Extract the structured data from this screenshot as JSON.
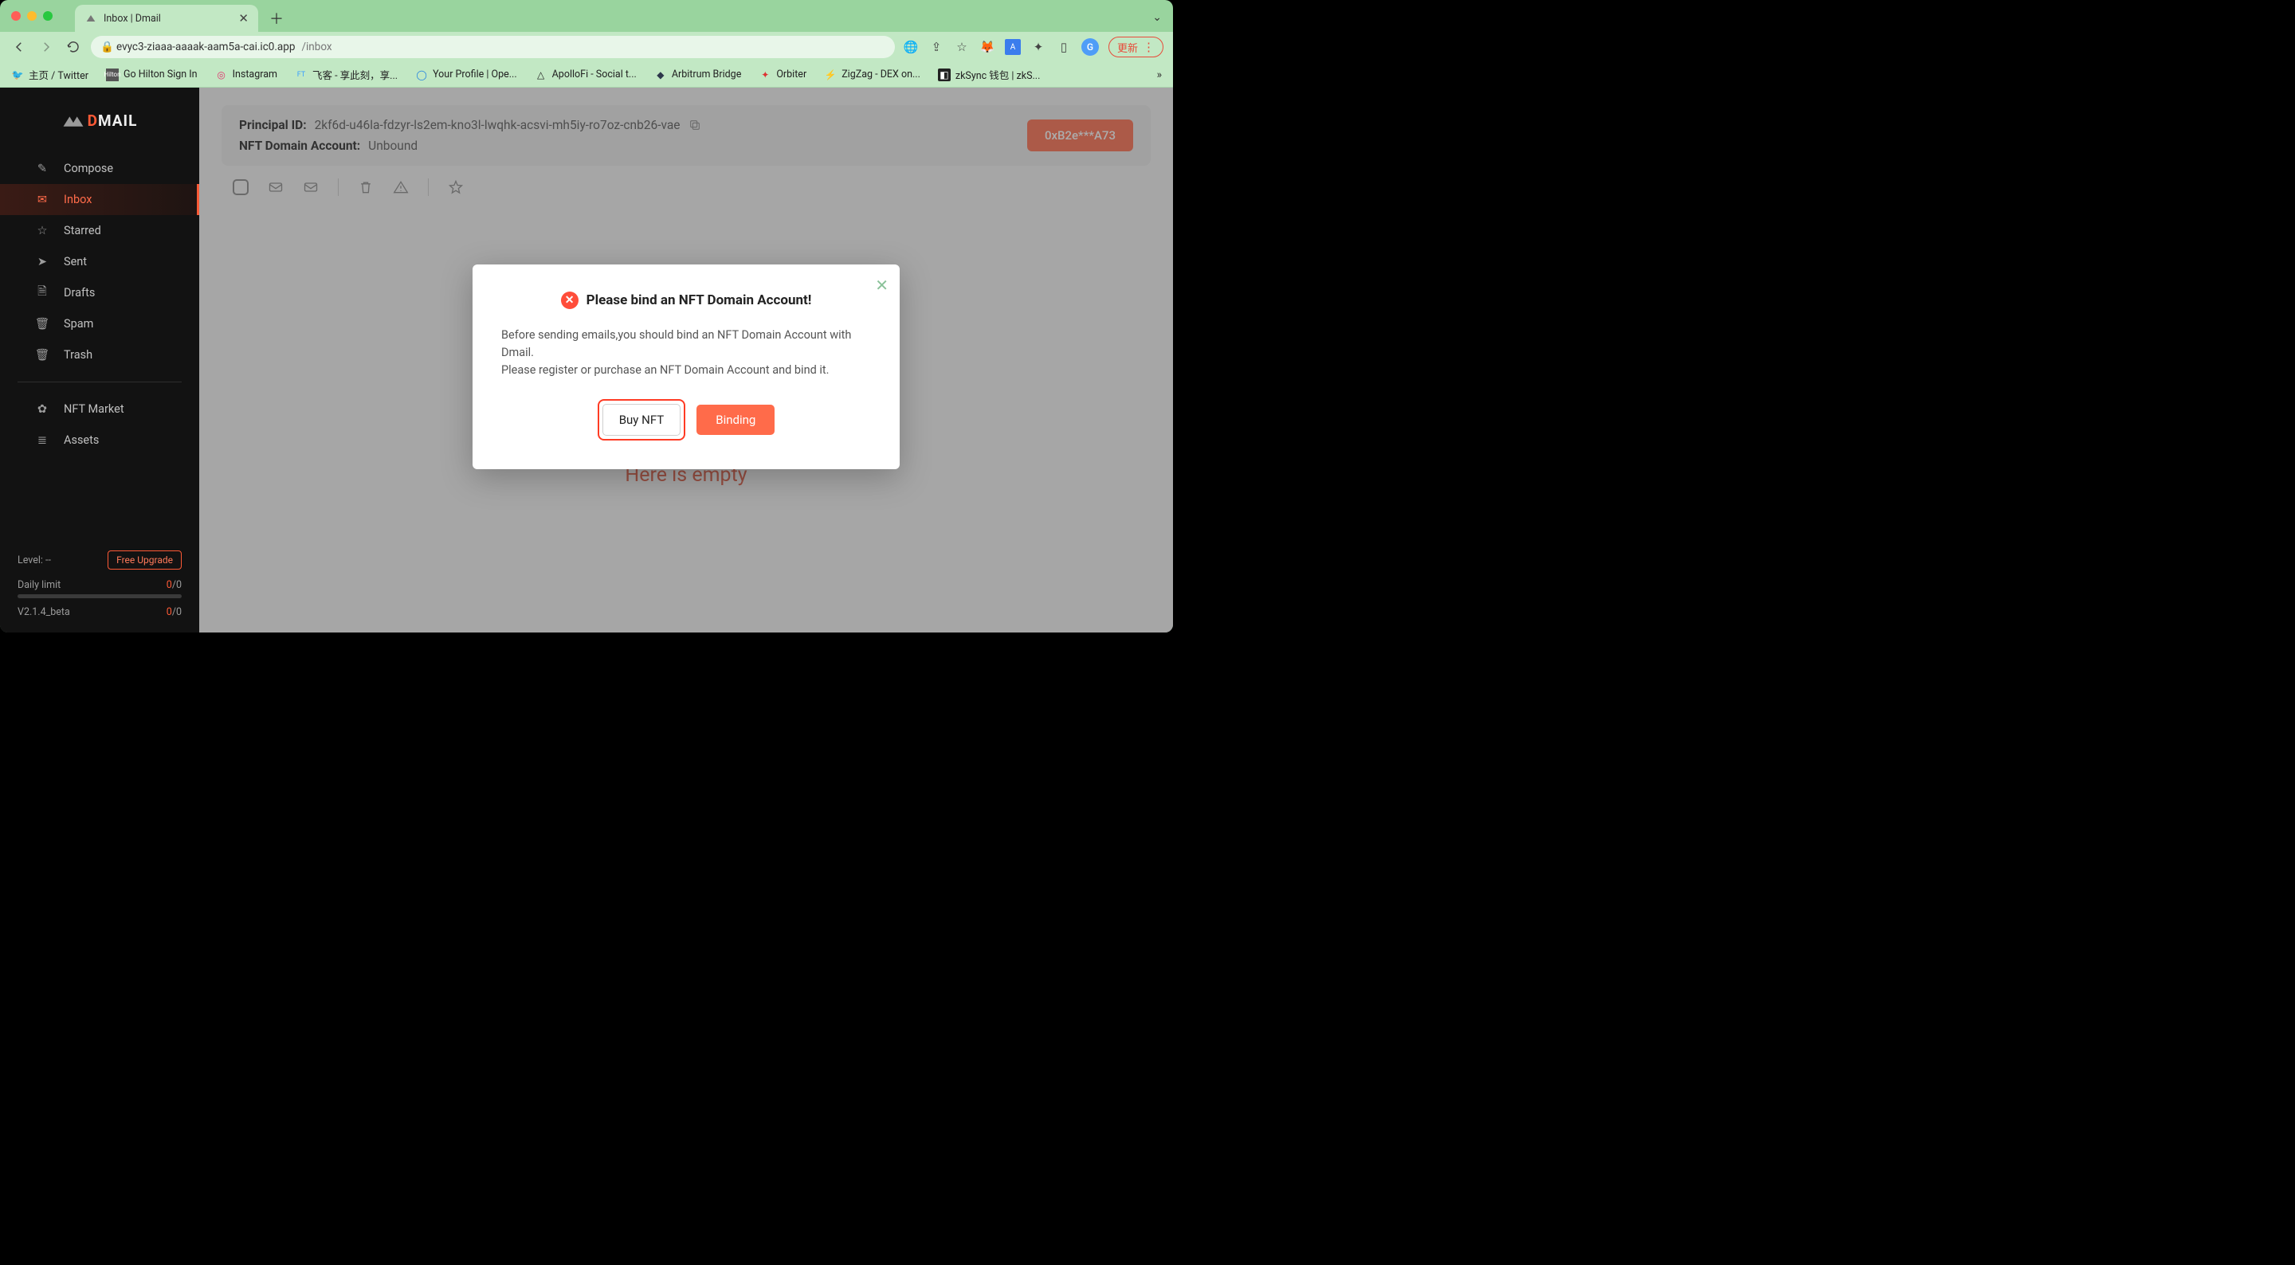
{
  "browser": {
    "tab_title": "Inbox | Dmail",
    "url_host": "evyc3-ziaaa-aaaak-aam5a-cai.ic0.app",
    "url_path": "/inbox",
    "avatar_letter": "G",
    "update_label": "更新"
  },
  "bookmarks": [
    {
      "label": "主页 / Twitter"
    },
    {
      "label": "Go Hilton Sign In"
    },
    {
      "label": "Instagram"
    },
    {
      "label": "飞客 - 享此刻，享..."
    },
    {
      "label": "Your Profile | Ope..."
    },
    {
      "label": "ApolloFi - Social t..."
    },
    {
      "label": "Arbitrum Bridge"
    },
    {
      "label": "Orbiter"
    },
    {
      "label": "ZigZag - DEX on..."
    },
    {
      "label": "zkSync 钱包 | zkS..."
    }
  ],
  "sidebar": {
    "brand_d": "D",
    "brand_mail": "MAIL",
    "items": [
      {
        "label": "Compose"
      },
      {
        "label": "Inbox"
      },
      {
        "label": "Starred"
      },
      {
        "label": "Sent"
      },
      {
        "label": "Drafts"
      },
      {
        "label": "Spam"
      },
      {
        "label": "Trash"
      }
    ],
    "items2": [
      {
        "label": "NFT Market"
      },
      {
        "label": "Assets"
      }
    ],
    "level_label": "Level: --",
    "upgrade_label": "Free Upgrade",
    "daily_label": "Daily limit",
    "daily_used": "0",
    "daily_total": "/0",
    "version": "V2.1.4_beta",
    "version_used": "0",
    "version_total": "/0"
  },
  "header": {
    "principal_label": "Principal ID:",
    "principal_value": "2kf6d-u46la-fdzyr-ls2em-kno3l-lwqhk-acsvi-mh5iy-ro7oz-cnb26-vae",
    "nft_label": "NFT Domain Account:",
    "nft_value": "Unbound",
    "wallet": "0xB2e***A73"
  },
  "inbox": {
    "empty": "Here is empty"
  },
  "modal": {
    "title": "Please bind an NFT Domain Account!",
    "line1": "Before sending emails,you should bind an NFT Domain Account with Dmail.",
    "line2": "Please register or purchase an NFT Domain Account and bind it.",
    "buy_label": "Buy NFT",
    "binding_label": "Binding"
  }
}
